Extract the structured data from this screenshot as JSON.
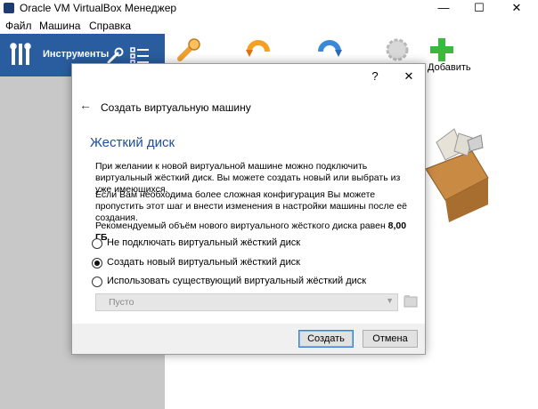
{
  "window": {
    "title": "Oracle VM VirtualBox Менеджер",
    "minimize": "—",
    "maximize": "☐",
    "close": "✕"
  },
  "menu": [
    "Файл",
    "Машина",
    "Справка"
  ],
  "toolbar": {
    "tools_label": "Инструменты",
    "add_label": "Добавить",
    "icons": [
      "settings-icon",
      "discard-icon",
      "start-icon",
      "new-icon",
      "add-icon"
    ]
  },
  "dialog": {
    "help": "?",
    "close": "✕",
    "back": "←",
    "caption": "Создать виртуальную машину",
    "section_title": "Жесткий диск",
    "paragraph1": "При желании к новой виртуальной машине можно подключить виртуальный жёсткий диск. Вы можете создать новый или выбрать из уже имеющихся.",
    "paragraph2": "Если Вам необходима более сложная конфигурация Вы можете пропустить этот шаг и внести изменения в настройки машины после её создания.",
    "recommended_text": "Рекомендуемый объём нового виртуального жёсткого диска равен ",
    "recommended_size": "8,00 ГБ",
    "recommended_end": ".",
    "options": [
      {
        "label": "Не подключать виртуальный жёсткий диск",
        "checked": false
      },
      {
        "label": "Создать новый виртуальный жёсткий диск",
        "checked": true
      },
      {
        "label": "Использовать существующий виртуальный жёсткий диск",
        "checked": false
      }
    ],
    "disk_select_value": "Пусто",
    "create_button": "Создать",
    "cancel_button": "Отмена"
  },
  "colors": {
    "accent": "#2a5d9f",
    "section_title": "#1f4e99"
  }
}
